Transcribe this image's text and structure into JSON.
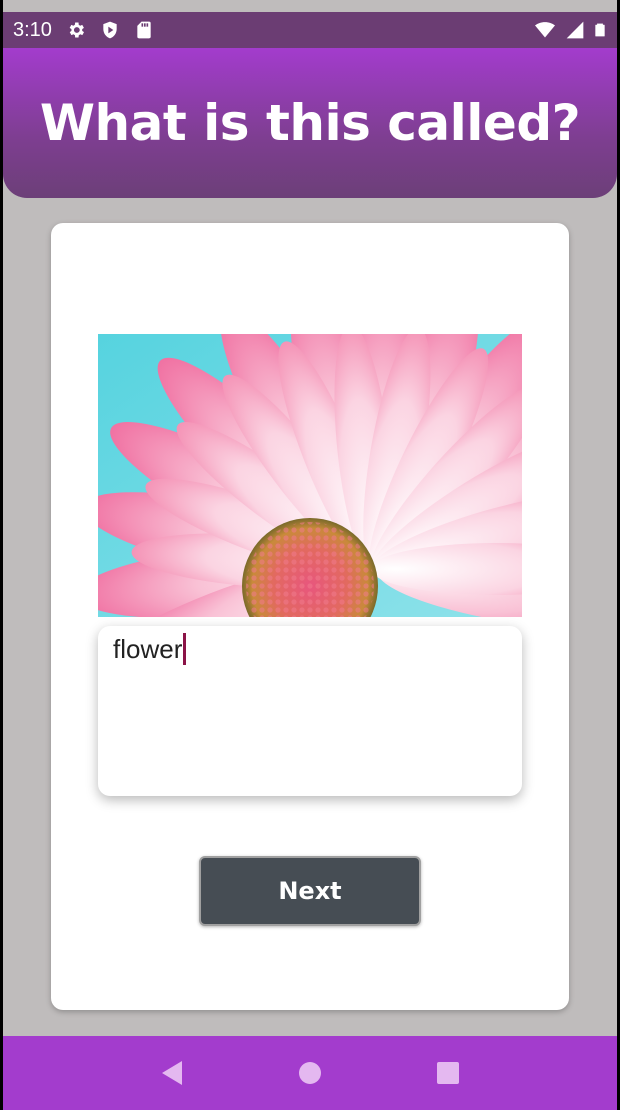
{
  "status_bar": {
    "time": "3:10",
    "left_icons": [
      "gear-icon",
      "shield-play-icon",
      "sd-card-icon"
    ],
    "right_icons": [
      "wifi-icon",
      "signal-icon",
      "battery-icon"
    ]
  },
  "header": {
    "title": "What is this called?"
  },
  "quiz": {
    "image_subject": "pink-flower-image",
    "answer_value": "flower",
    "next_label": "Next"
  },
  "nav_bar": {
    "buttons": [
      "back-icon",
      "home-icon",
      "recents-icon"
    ]
  },
  "colors": {
    "status_bar": "#6b3d73",
    "header_top": "#a33ccd",
    "header_bottom": "#6c3f78",
    "background": "#bfbcbc",
    "button": "#464d54",
    "caret": "#8b1347",
    "nav_bar": "#a33ccd"
  }
}
